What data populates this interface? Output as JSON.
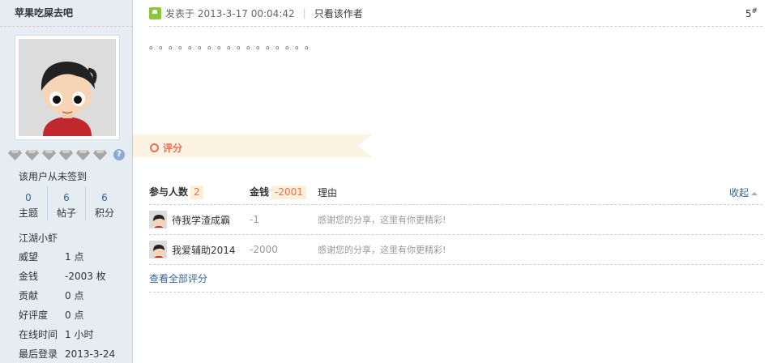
{
  "user": {
    "name": "苹果吃屎去吧",
    "checkin": "该用户从未签到",
    "stats": [
      {
        "value": "0",
        "label": "主题"
      },
      {
        "value": "6",
        "label": "帖子"
      },
      {
        "value": "6",
        "label": "积分"
      }
    ],
    "rank": "江湖小虾",
    "info": [
      {
        "key": "威望",
        "value": "1 点"
      },
      {
        "key": "金钱",
        "value": "-2003 枚"
      },
      {
        "key": "贡献",
        "value": "0 点"
      },
      {
        "key": "好评度",
        "value": "0 点"
      },
      {
        "key": "在线时间",
        "value": "1 小时"
      },
      {
        "key": "最后登录",
        "value": "2013-3-24"
      }
    ],
    "help_icon_label": "?"
  },
  "post": {
    "time": "发表于 2013-3-17 00:04:42",
    "separator": "|",
    "only_author": "只看该作者",
    "floor_num": "5",
    "floor_mark": "#",
    "body": "。。。。。。。。。。。。。。。。。"
  },
  "rating": {
    "title": "评分",
    "participants_label": "参与人数",
    "participants_count": "2",
    "money_label": "金钱",
    "money_total": "-2001",
    "reason_label": "理由",
    "collapse_label": "收起",
    "rows": [
      {
        "user": "待我学渣成霸",
        "amount": "-1",
        "reason": "感谢您的分享，这里有你更精彩!"
      },
      {
        "user": "我爱辅助2014",
        "amount": "-2000",
        "reason": "感谢您的分享，这里有你更精彩!"
      }
    ],
    "view_all": "查看全部评分"
  },
  "colors": {
    "accent": "#f26c4f",
    "link": "#336699",
    "sidebar_bg": "#e5edf2"
  }
}
